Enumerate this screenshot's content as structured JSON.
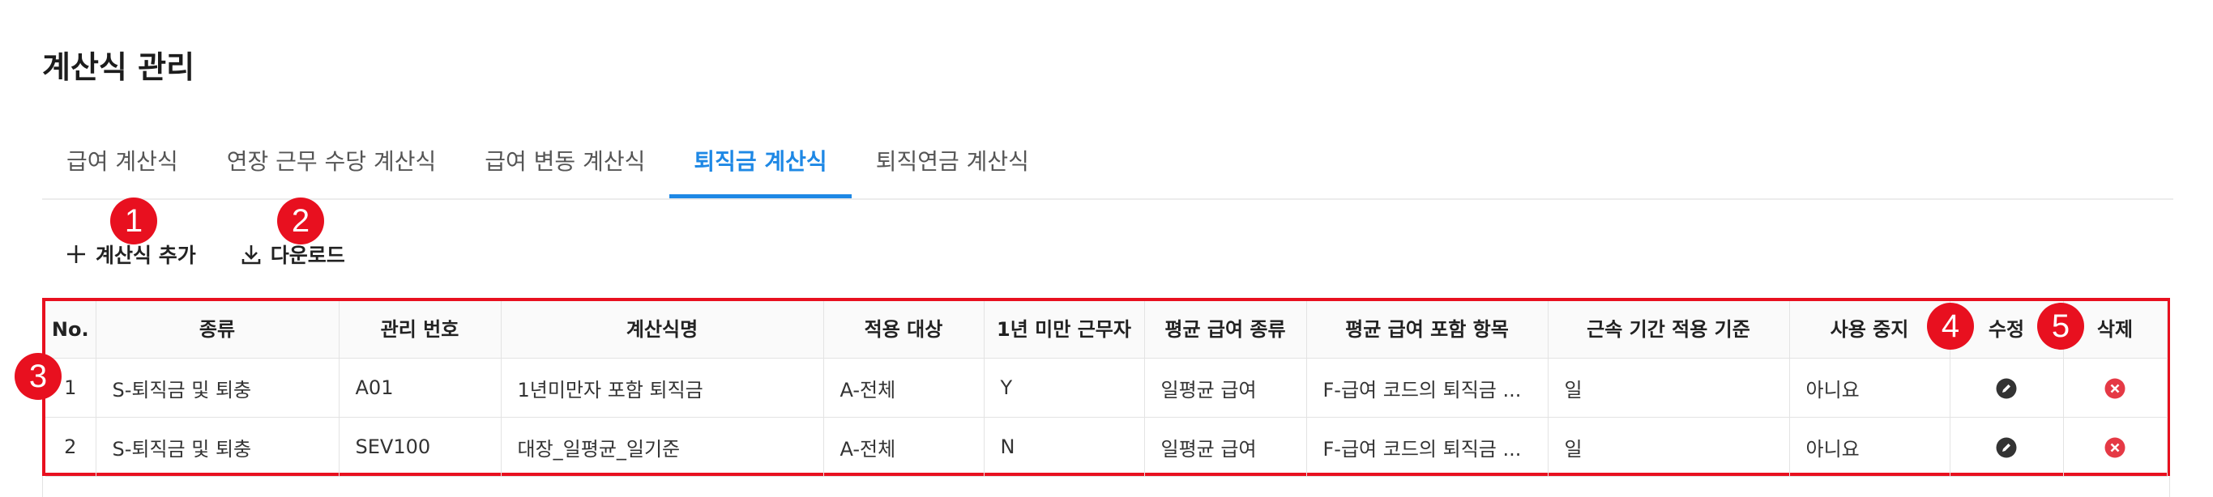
{
  "page": {
    "title": "계산식 관리"
  },
  "tabs": [
    {
      "label": "급여 계산식",
      "active": false
    },
    {
      "label": "연장 근무 수당 계산식",
      "active": false
    },
    {
      "label": "급여 변동 계산식",
      "active": false
    },
    {
      "label": "퇴직금 계산식",
      "active": true
    },
    {
      "label": "퇴직연금 계산식",
      "active": false
    }
  ],
  "toolbar": {
    "add_label": "계산식 추가",
    "download_label": "다운로드"
  },
  "callouts": [
    "1",
    "2",
    "3",
    "4",
    "5"
  ],
  "table": {
    "headers": [
      "No.",
      "종류",
      "관리 번호",
      "계산식명",
      "적용 대상",
      "1년 미만 근무자",
      "평균 급여 종류",
      "평균 급여 포함 항목",
      "근속 기간 적용 기준",
      "사용 중지",
      "수정",
      "삭제"
    ],
    "rows": [
      {
        "no": "1",
        "type": "S-퇴직금 및 퇴충",
        "code": "A01",
        "name": "1년미만자 포함 퇴직금",
        "target": "A-전체",
        "under_one_year": "Y",
        "avg_pay_type": "일평균 급여",
        "avg_pay_items": "F-급여 코드의 퇴직금 ...",
        "tenure_basis": "일",
        "suspended": "아니요"
      },
      {
        "no": "2",
        "type": "S-퇴직금 및 퇴충",
        "code": "SEV100",
        "name": "대장_일평균_일기준",
        "target": "A-전체",
        "under_one_year": "N",
        "avg_pay_type": "일평균 급여",
        "avg_pay_items": "F-급여 코드의 퇴직금 ...",
        "tenure_basis": "일",
        "suspended": "아니요"
      }
    ]
  },
  "colors": {
    "accent": "#1e88e5",
    "callout": "#e8101f",
    "delete": "#e53945",
    "edit": "#333333"
  },
  "icons": {
    "add": "plus-icon",
    "download": "download-icon",
    "edit": "pencil-icon",
    "delete": "close-circle-icon"
  }
}
